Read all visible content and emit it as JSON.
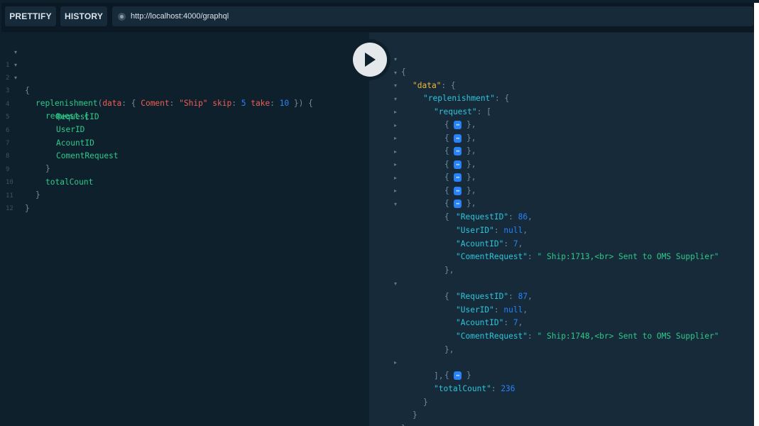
{
  "toolbar": {
    "prettify_label": "PRETTIFY",
    "history_label": "HISTORY",
    "url": "http://localhost:4000/graphql"
  },
  "query": {
    "line_numbers": [
      "1",
      "2",
      "3",
      "4",
      "5",
      "6",
      "7",
      "8",
      "9",
      "10",
      "11",
      "12"
    ],
    "line1": "{",
    "line2_field": "replenishment",
    "line2_open": "(",
    "line2_arg": "data",
    "line2_colon": ": { ",
    "line2_key": "Coment",
    "line2_colon2": ": ",
    "line2_str": "\"Ship\"",
    "line2_skip": " skip",
    "line2_colon3": ": ",
    "line2_skipval": "5",
    "line2_take": " take",
    "line2_colon4": ": ",
    "line2_takeval": "10",
    "line2_close": " }) {",
    "line3": "request {",
    "line4": "RequestID",
    "line5": "UserID",
    "line6": "AcountID",
    "line7": "ComentRequest",
    "line8": "}",
    "line9": "totalCount",
    "line10": "}",
    "line11": "}"
  },
  "result": {
    "open_brace": "{",
    "data_key": "\"data\"",
    "colon_brace": ": {",
    "replenishment_key": "\"replenishment\"",
    "request_key": "\"request\"",
    "colon_bracket": ": [",
    "collapsed_glyph": "↔",
    "collapsed_open": "{ ",
    "collapsed_close": " },",
    "collapsed_close_last": " }",
    "item_open": "{",
    "item_close": "},",
    "items": [
      {
        "request_id_key": "\"RequestID\"",
        "request_id": "86",
        "user_id_key": "\"UserID\"",
        "user_id": "null",
        "acount_id_key": "\"AcountID\"",
        "acount_id": "7",
        "coment_key": "\"ComentRequest\"",
        "coment": "\" Ship:1713,<br> Sent to OMS Supplier\""
      },
      {
        "request_id_key": "\"RequestID\"",
        "request_id": "87",
        "user_id_key": "\"UserID\"",
        "user_id": "null",
        "acount_id_key": "\"AcountID\"",
        "acount_id": "7",
        "coment_key": "\"ComentRequest\"",
        "coment": "\" Ship:1748,<br> Sent to OMS Supplier\""
      }
    ],
    "close_bracket": "],",
    "total_count_key": "\"totalCount\"",
    "total_count": "236",
    "close_brace": "}"
  }
}
